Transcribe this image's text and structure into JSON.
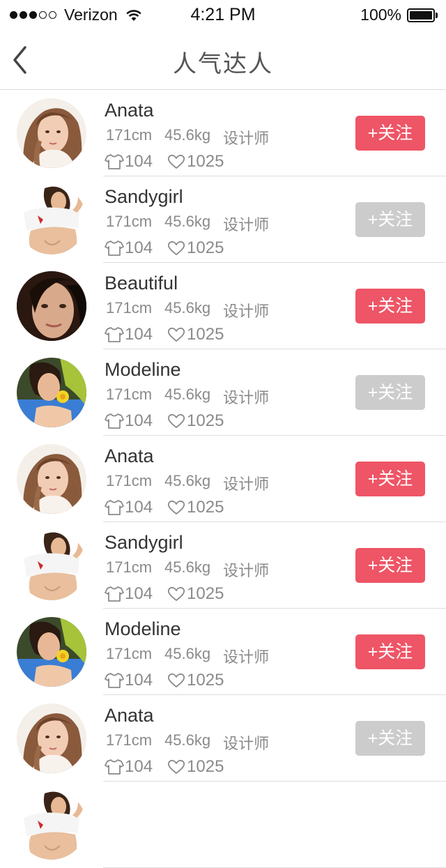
{
  "status_bar": {
    "carrier": "Verizon",
    "time": "4:21 PM",
    "battery": "100%"
  },
  "nav": {
    "title": "人气达人",
    "back_icon": "chevron-left-icon"
  },
  "colors": {
    "follow_active": "#ee5566",
    "follow_inactive": "#cccccc",
    "meta_text": "#8a8a8a"
  },
  "users": [
    {
      "name": "Anata",
      "height": "171cm",
      "weight": "45.6kg",
      "job": "设计师",
      "outfits": "104",
      "likes": "1025",
      "follow_label": "+关注",
      "followed": false,
      "avatar": "a"
    },
    {
      "name": "Sandygirl",
      "height": "171cm",
      "weight": "45.6kg",
      "job": "设计师",
      "outfits": "104",
      "likes": "1025",
      "follow_label": "+关注",
      "followed": true,
      "avatar": "b"
    },
    {
      "name": "Beautiful",
      "height": "171cm",
      "weight": "45.6kg",
      "job": "设计师",
      "outfits": "104",
      "likes": "1025",
      "follow_label": "+关注",
      "followed": false,
      "avatar": "c"
    },
    {
      "name": "Modeline",
      "height": "171cm",
      "weight": "45.6kg",
      "job": "设计师",
      "outfits": "104",
      "likes": "1025",
      "follow_label": "+关注",
      "followed": true,
      "avatar": "d"
    },
    {
      "name": "Anata",
      "height": "171cm",
      "weight": "45.6kg",
      "job": "设计师",
      "outfits": "104",
      "likes": "1025",
      "follow_label": "+关注",
      "followed": false,
      "avatar": "a"
    },
    {
      "name": "Sandygirl",
      "height": "171cm",
      "weight": "45.6kg",
      "job": "设计师",
      "outfits": "104",
      "likes": "1025",
      "follow_label": "+关注",
      "followed": false,
      "avatar": "b"
    },
    {
      "name": "Modeline",
      "height": "171cm",
      "weight": "45.6kg",
      "job": "设计师",
      "outfits": "104",
      "likes": "1025",
      "follow_label": "+关注",
      "followed": false,
      "avatar": "d"
    },
    {
      "name": "Anata",
      "height": "171cm",
      "weight": "45.6kg",
      "job": "设计师",
      "outfits": "104",
      "likes": "1025",
      "follow_label": "+关注",
      "followed": true,
      "avatar": "a"
    },
    {
      "name": "",
      "height": "",
      "weight": "",
      "job": "",
      "outfits": "",
      "likes": "",
      "follow_label": "",
      "followed": false,
      "avatar": "b"
    }
  ]
}
